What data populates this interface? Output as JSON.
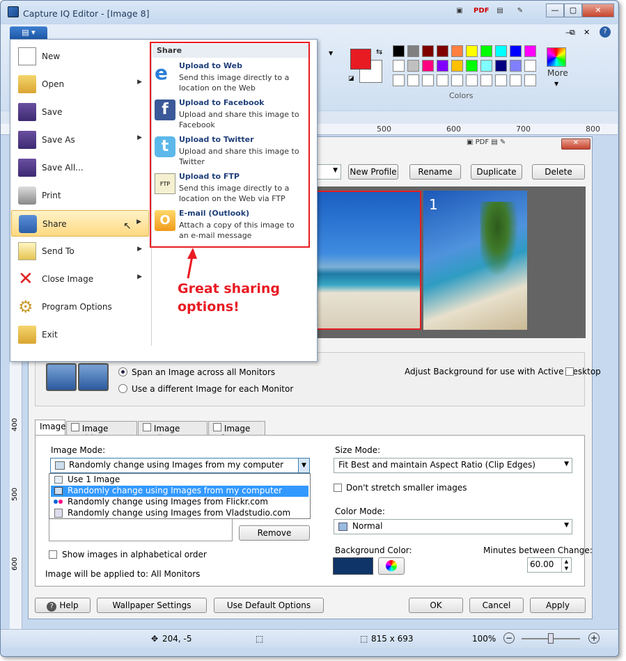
{
  "window": {
    "title": "Capture IQ Editor - [Image 8]"
  },
  "ribbon": {
    "colors_group_label": "Colors",
    "more_label": "More",
    "ruler_ticks": [
      "500",
      "600",
      "700",
      "800"
    ],
    "swatch_colors": [
      "#000000",
      "#808080",
      "#800000",
      "#800000",
      "#ff8040",
      "#ffff00",
      "#00ff00",
      "#00ffff",
      "#0000ff",
      "#ff00ff",
      "#ffffff",
      "#c0c0c0",
      "#ff0080",
      "#8000ff",
      "#ffc000",
      "#00ff00",
      "#80ffff",
      "#000080",
      "#8080ff",
      "#ffffff",
      "#ffffff",
      "#ffffff",
      "#ffffff",
      "#ffffff",
      "#ffffff",
      "#ffffff",
      "#ffffff",
      "#ffffff",
      "#ffffff",
      "#ffffff"
    ],
    "primary_color": "#e81b23"
  },
  "file_menu": {
    "items": [
      {
        "label": "New",
        "icon": "new-document-icon"
      },
      {
        "label": "Open",
        "icon": "open-folder-icon"
      },
      {
        "label": "Save",
        "icon": "save-disk-icon"
      },
      {
        "label": "Save As",
        "icon": "save-as-icon"
      },
      {
        "label": "Save All...",
        "icon": "save-all-icon"
      },
      {
        "label": "Print",
        "icon": "printer-icon"
      },
      {
        "label": "Share",
        "icon": "share-icon"
      },
      {
        "label": "Send To",
        "icon": "send-to-icon"
      },
      {
        "label": "Close Image",
        "icon": "close-x-icon"
      },
      {
        "label": "Program Options",
        "icon": "gears-icon"
      },
      {
        "label": "Exit",
        "icon": "exit-icon"
      }
    ]
  },
  "share_panel": {
    "header": "Share",
    "items": [
      {
        "title": "Upload to Web",
        "desc": "Send this image directly to a location on the Web"
      },
      {
        "title": "Upload to Facebook",
        "desc": "Upload and share this image to Facebook"
      },
      {
        "title": "Upload to Twitter",
        "desc": "Upload and share this image to Twitter"
      },
      {
        "title": "Upload to FTP",
        "desc": "Send this image directly to a location on the Web via FTP"
      },
      {
        "title": "E-mail (Outlook)",
        "desc": "Attach a copy of this image to an e-mail message"
      }
    ],
    "callout": "Great sharing options!"
  },
  "profile_bar": {
    "new_profile": "New Profile",
    "rename": "Rename",
    "duplicate": "Duplicate",
    "delete": "Delete"
  },
  "preview": {
    "monitor_number": "1"
  },
  "monitors": {
    "span_option": "Span an Image across all Monitors",
    "different_option": "Use a different Image for each Monitor",
    "adjust_label": "Adjust Background for use with Active Desktop"
  },
  "tabs": [
    "Image",
    "Image Position",
    "Image Scaling",
    "Image Info"
  ],
  "image_tab": {
    "image_mode_label": "Image Mode:",
    "image_mode_value": "Randomly change using Images from my computer",
    "dropdown_options": [
      "Use 1 Image",
      "Randomly change using Images from my computer",
      "Randomly change using Images from Flickr.com",
      "Randomly change using Images from Vladstudio.com"
    ],
    "remove": "Remove",
    "alpha_order": "Show images in alphabetical order",
    "applied_to": "Image will be applied to: All Monitors",
    "size_mode_label": "Size Mode:",
    "size_mode_value": "Fit Best and maintain Aspect Ratio (Clip Edges)",
    "dont_stretch": "Don't stretch smaller images",
    "color_mode_label": "Color Mode:",
    "color_mode_value": "Normal",
    "bg_color_label": "Background Color:",
    "bg_color": "#0f3467",
    "minutes_label": "Minutes between Change:",
    "minutes_value": "60.00"
  },
  "footer": {
    "help": "Help",
    "wallpaper_settings": "Wallpaper Settings",
    "use_default": "Use Default Options",
    "ok": "OK",
    "cancel": "Cancel",
    "apply": "Apply"
  },
  "vruler_ticks": [
    "400",
    "500",
    "600"
  ],
  "status_bar": {
    "cursor_pos": "204, -5",
    "size": "815 x 693",
    "zoom": "100%"
  }
}
